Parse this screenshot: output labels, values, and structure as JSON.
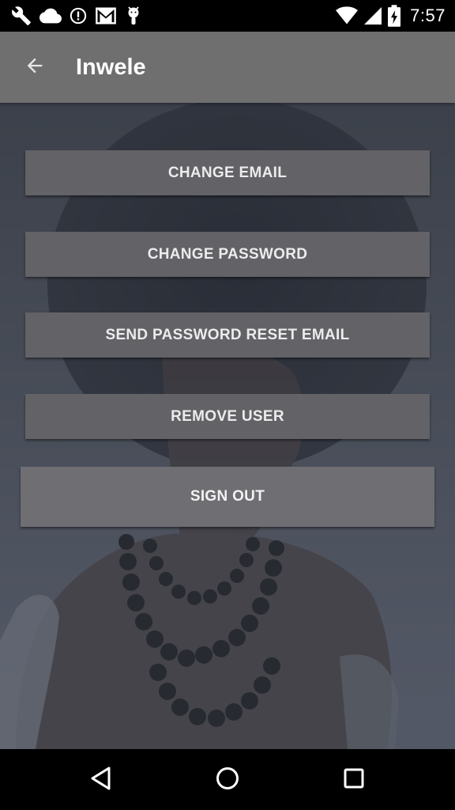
{
  "status_bar": {
    "time": "7:57",
    "left_icons": [
      "wrench-icon",
      "cloud-icon",
      "info-circle-icon",
      "gmail-icon",
      "android-debug-icon"
    ],
    "right_icons": [
      "wifi-icon",
      "cellular-signal-icon",
      "battery-charging-icon"
    ]
  },
  "toolbar": {
    "title": "Inwele",
    "back_icon": "arrow-back-icon"
  },
  "buttons": {
    "change_email": "CHANGE EMAIL",
    "change_password": "CHANGE PASSWORD",
    "send_reset_email": "SEND PASSWORD RESET EMAIL",
    "remove_user": "REMOVE USER",
    "sign_out": "SIGN OUT"
  },
  "nav_bar": {
    "icons": [
      "nav-back-icon",
      "nav-home-icon",
      "nav-recents-icon"
    ]
  },
  "colors": {
    "toolbar_bg": "#6f6f6f",
    "button_bg": "#626267",
    "sign_out_bg": "#6e6e73",
    "button_text": "#ececec"
  }
}
